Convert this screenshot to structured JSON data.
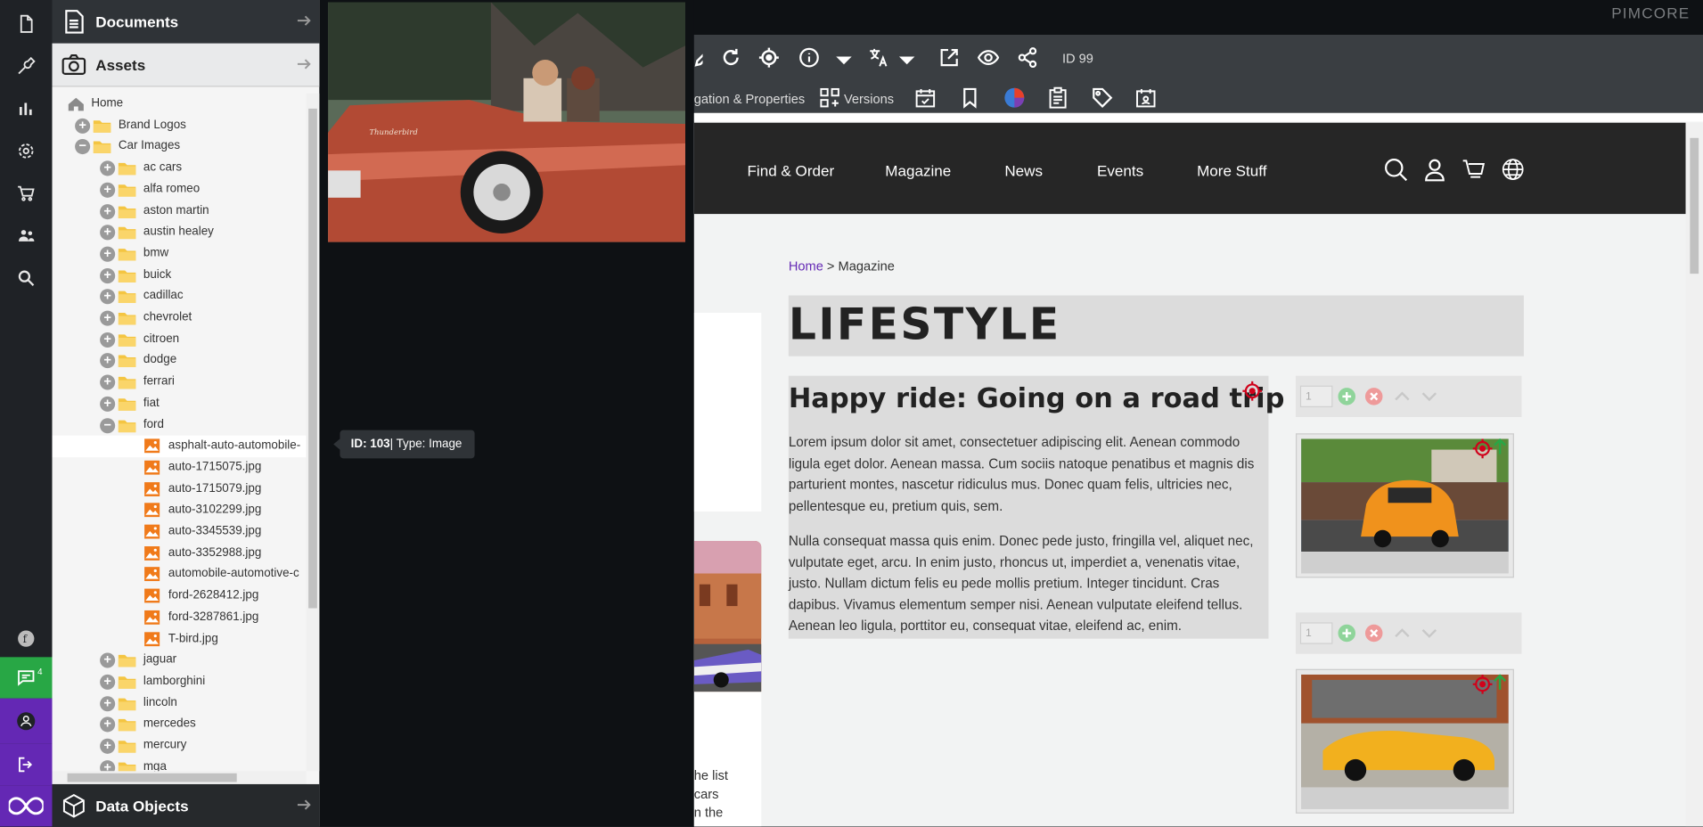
{
  "sidebar": {
    "documents_label": "Documents",
    "assets_label": "Assets",
    "data_objects_label": "Data Objects",
    "notifications_count": "4"
  },
  "tree": {
    "nodes": [
      {
        "label": "Home",
        "level": 0,
        "type": "home"
      },
      {
        "label": "Brand Logos",
        "level": 1,
        "type": "folder",
        "expander": "plus"
      },
      {
        "label": "Car Images",
        "level": 1,
        "type": "folder",
        "expander": "minus"
      },
      {
        "label": "ac cars",
        "level": 2,
        "type": "folder",
        "expander": "plus"
      },
      {
        "label": "alfa romeo",
        "level": 2,
        "type": "folder",
        "expander": "plus"
      },
      {
        "label": "aston martin",
        "level": 2,
        "type": "folder",
        "expander": "plus"
      },
      {
        "label": "austin healey",
        "level": 2,
        "type": "folder",
        "expander": "plus"
      },
      {
        "label": "bmw",
        "level": 2,
        "type": "folder",
        "expander": "plus"
      },
      {
        "label": "buick",
        "level": 2,
        "type": "folder",
        "expander": "plus"
      },
      {
        "label": "cadillac",
        "level": 2,
        "type": "folder",
        "expander": "plus"
      },
      {
        "label": "chevrolet",
        "level": 2,
        "type": "folder",
        "expander": "plus"
      },
      {
        "label": "citroen",
        "level": 2,
        "type": "folder",
        "expander": "plus"
      },
      {
        "label": "dodge",
        "level": 2,
        "type": "folder",
        "expander": "plus"
      },
      {
        "label": "ferrari",
        "level": 2,
        "type": "folder",
        "expander": "plus"
      },
      {
        "label": "fiat",
        "level": 2,
        "type": "folder",
        "expander": "plus"
      },
      {
        "label": "ford",
        "level": 2,
        "type": "folder",
        "expander": "minus"
      },
      {
        "label": "asphalt-auto-automobile-",
        "level": 3,
        "type": "image",
        "selected": true
      },
      {
        "label": "auto-1715075.jpg",
        "level": 3,
        "type": "image"
      },
      {
        "label": "auto-1715079.jpg",
        "level": 3,
        "type": "image"
      },
      {
        "label": "auto-3102299.jpg",
        "level": 3,
        "type": "image"
      },
      {
        "label": "auto-3345539.jpg",
        "level": 3,
        "type": "image"
      },
      {
        "label": "auto-3352988.jpg",
        "level": 3,
        "type": "image"
      },
      {
        "label": "automobile-automotive-c",
        "level": 3,
        "type": "image"
      },
      {
        "label": "ford-2628412.jpg",
        "level": 3,
        "type": "image"
      },
      {
        "label": "ford-3287861.jpg",
        "level": 3,
        "type": "image"
      },
      {
        "label": "T-bird.jpg",
        "level": 3,
        "type": "image"
      },
      {
        "label": "jaguar",
        "level": 2,
        "type": "folder",
        "expander": "plus"
      },
      {
        "label": "lamborghini",
        "level": 2,
        "type": "folder",
        "expander": "plus"
      },
      {
        "label": "lincoln",
        "level": 2,
        "type": "folder",
        "expander": "plus"
      },
      {
        "label": "mercedes",
        "level": 2,
        "type": "folder",
        "expander": "plus"
      },
      {
        "label": "mercury",
        "level": 2,
        "type": "folder",
        "expander": "plus"
      },
      {
        "label": "mga",
        "level": 2,
        "type": "folder",
        "expander": "plus"
      }
    ]
  },
  "tooltip": {
    "id_label": "ID: 103",
    "type_label": " | Type: Image"
  },
  "topbar": {
    "brand": "PIMCORE"
  },
  "toolbar": {
    "doc_id": "ID 99",
    "nav_props_label": "gation & Properties",
    "versions_label": "Versions"
  },
  "site": {
    "nav": [
      "Find & Order",
      "Magazine",
      "News",
      "Events",
      "More Stuff"
    ],
    "breadcrumb_home": "Home",
    "breadcrumb_sep": " > ",
    "breadcrumb_current": "Magazine",
    "heading": "LIFESTYLE",
    "article_title": "Happy ride: Going on a road trip",
    "para1": "Lorem ipsum dolor sit amet, consectetuer adipiscing elit. Aenean commodo ligula eget dolor. Aenean massa. Cum sociis natoque penatibus et magnis dis parturient montes, nascetur ridiculus mus. Donec quam felis, ultricies nec, pellentesque eu, pretium quis, sem.",
    "para2": "Nulla consequat massa quis enim. Donec pede justo, fringilla vel, aliquet nec, vulputate eget, arcu. In enim justo, rhoncus ut, imperdiet a, venenatis vitae, justo. Nullam dictum felis eu pede mollis pretium. Integer tincidunt. Cras dapibus. Vivamus elementum semper nisi. Aenean vulputate eleifend tellus. Aenean leo ligula, porttitor eu, consequat vitae, eleifend ac, enim.",
    "block_index": "1",
    "left_text": [
      "he list",
      "cars",
      "n the"
    ]
  },
  "colors": {
    "accent": "#6428b4",
    "green": "#28a745",
    "target_red": "#d0021b"
  }
}
